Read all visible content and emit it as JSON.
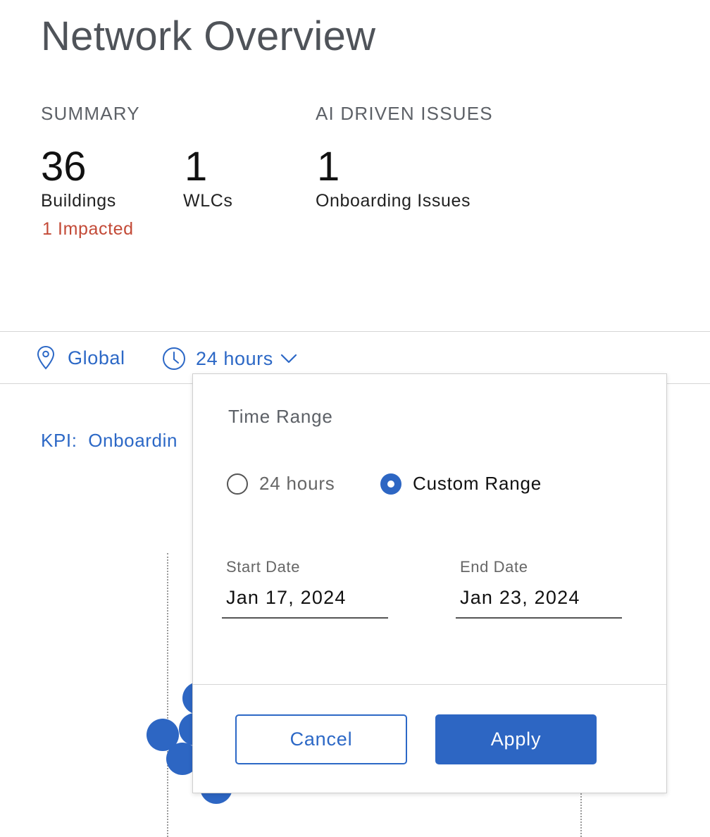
{
  "page": {
    "title": "Network Overview"
  },
  "summary": {
    "label": "SUMMARY",
    "buildings": {
      "value": "36",
      "label": "Buildings",
      "impacted": "1 Impacted"
    },
    "wlcs": {
      "value": "1",
      "label": "WLCs"
    }
  },
  "ai_issues": {
    "label": "AI DRIVEN ISSUES",
    "onboarding": {
      "value": "1",
      "label": "Onboarding Issues"
    }
  },
  "filters": {
    "location": {
      "label": "Global",
      "icon": "location-pin-icon"
    },
    "time": {
      "label": "24 hours",
      "icon": "clock-icon",
      "caret": "chevron-down-icon"
    }
  },
  "kpi": {
    "prefix": "KPI:",
    "value": "Onboardin"
  },
  "time_range_popover": {
    "title": "Time Range",
    "options": [
      {
        "label": "24 hours",
        "selected": false
      },
      {
        "label": "Custom Range",
        "selected": true
      }
    ],
    "start_date": {
      "label": "Start Date",
      "value": "Jan 17, 2024"
    },
    "end_date": {
      "label": "End Date",
      "value": "Jan 23, 2024"
    },
    "cancel_label": "Cancel",
    "apply_label": "Apply"
  },
  "colors": {
    "accent": "#2c68c6",
    "impacted": "#c34a37",
    "text": "#111111",
    "muted": "#5d6167"
  }
}
